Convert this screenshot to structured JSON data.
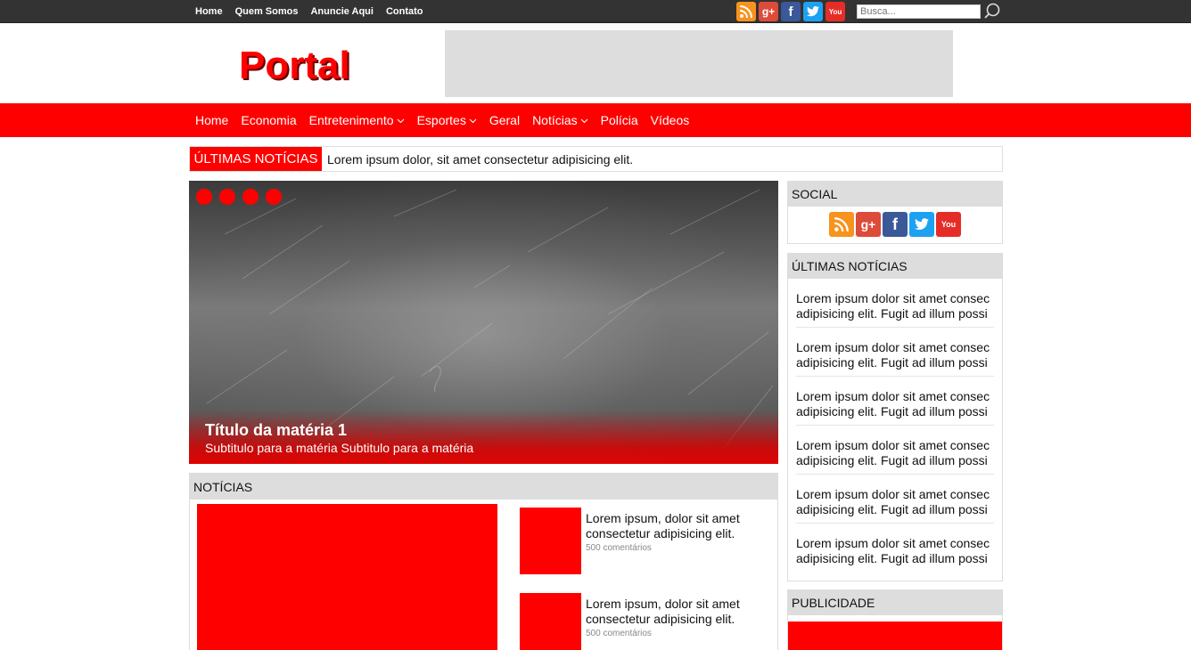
{
  "topbar": {
    "links": [
      "Home",
      "Quem Somos",
      "Anuncie Aqui",
      "Contato"
    ],
    "social_icons": [
      "rss-icon",
      "google-plus-icon",
      "facebook-icon",
      "twitter-icon",
      "youtube-icon"
    ],
    "search": {
      "placeholder": "Busca..."
    }
  },
  "header": {
    "logo": "Portal"
  },
  "nav": {
    "items": [
      {
        "label": "Home",
        "has_dropdown": false
      },
      {
        "label": "Economia",
        "has_dropdown": false
      },
      {
        "label": "Entretenimento",
        "has_dropdown": true
      },
      {
        "label": "Esportes",
        "has_dropdown": true
      },
      {
        "label": "Geral",
        "has_dropdown": false
      },
      {
        "label": "Notícias",
        "has_dropdown": true
      },
      {
        "label": "Polícia",
        "has_dropdown": false
      },
      {
        "label": "Vídeos",
        "has_dropdown": false
      }
    ]
  },
  "ticker": {
    "label": "ÚLTIMAS NOTÍCIAS",
    "text": "Lorem ipsum dolor, sit amet consectetur adipisicing elit."
  },
  "slider": {
    "dot_count": 4,
    "title": "Título da matéria 1",
    "subtitle": "Subtitulo para a matéria Subtitulo para a matéria"
  },
  "news": {
    "heading": "NOTÍCIAS",
    "items": [
      {
        "title": "Lorem ipsum, dolor sit amet consectetur adipisicing elit.",
        "comments": "500 comentários"
      },
      {
        "title": "Lorem ipsum, dolor sit amet consectetur adipisicing elit.",
        "comments": "500 comentários"
      }
    ]
  },
  "sidebar": {
    "social_heading": "SOCIAL",
    "latest_heading": "ÚLTIMAS NOTÍCIAS",
    "latest_items": [
      {
        "line1": "Lorem ipsum dolor sit amet consec",
        "line2": "adipisicing elit. Fugit ad illum possi"
      },
      {
        "line1": "Lorem ipsum dolor sit amet consec",
        "line2": "adipisicing elit. Fugit ad illum possi"
      },
      {
        "line1": "Lorem ipsum dolor sit amet consec",
        "line2": "adipisicing elit. Fugit ad illum possi"
      },
      {
        "line1": "Lorem ipsum dolor sit amet consec",
        "line2": "adipisicing elit. Fugit ad illum possi"
      },
      {
        "line1": "Lorem ipsum dolor sit amet consec",
        "line2": "adipisicing elit. Fugit ad illum possi"
      },
      {
        "line1": "Lorem ipsum dolor sit amet consec",
        "line2": "adipisicing elit. Fugit ad illum possi"
      }
    ],
    "ad_heading": "PUBLICIDADE"
  },
  "colors": {
    "brand_red": "#ff0000",
    "topbar_bg": "#333333",
    "panel_gray": "#dddddd",
    "rss": "#f7931e",
    "google_plus": "#dd4b39",
    "facebook": "#3b5998",
    "twitter": "#1da1f2",
    "youtube": "#e52d27"
  }
}
